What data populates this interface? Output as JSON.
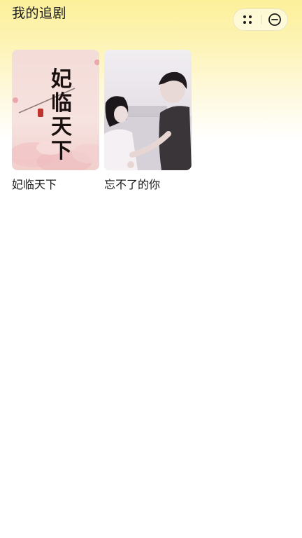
{
  "header": {
    "title": "我的追剧",
    "more_icon": "four-dots-icon",
    "close_icon": "minus-circle-icon"
  },
  "dramas": [
    {
      "title": "妃临天下",
      "poster_text": "妃临天下"
    },
    {
      "title": "忘不了的你"
    }
  ],
  "colors": {
    "header_gradient_top": "#fdf09a",
    "background": "#ffffff",
    "text": "#1a1a1a"
  }
}
